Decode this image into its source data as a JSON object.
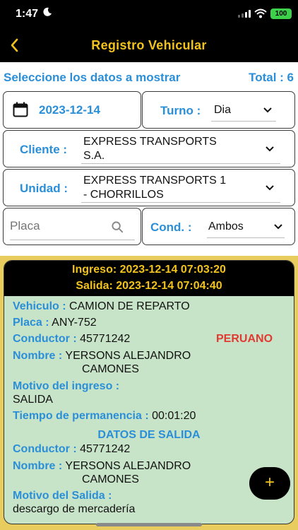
{
  "status": {
    "time": "1:47",
    "battery": "100"
  },
  "nav": {
    "title": "Registro Vehicular"
  },
  "header": {
    "prompt": "Seleccione los datos a mostrar",
    "total": "Total : 6"
  },
  "filters": {
    "date": "2023-12-14",
    "turno_label": "Turno :",
    "turno_value": "Dia",
    "cliente_label": "Cliente :",
    "cliente_line1": "EXPRESS TRANSPORTS",
    "cliente_line2": "S.A.",
    "unidad_label": "Unidad :",
    "unidad_line1": "EXPRESS TRANSPORTS 1",
    "unidad_line2": "- CHORRILLOS",
    "placa_placeholder": "Placa",
    "cond_label": "Cond. :",
    "cond_value": "Ambos"
  },
  "record": {
    "ingreso": "Ingreso: 2023-12-14 07:03:20",
    "salida": "Salida: 2023-12-14 07:04:40",
    "vehiculo_label": "Vehiculo :",
    "vehiculo": "CAMION DE REPARTO",
    "placa_label": "Placa :",
    "placa": "ANY-752",
    "conductor_label": "Conductor :",
    "conductor": "45771242",
    "nacionalidad": "PERUANO",
    "nombre_label": "Nombre :",
    "nombre_line1": "YERSONS ALEJANDRO",
    "nombre_line2": "CAMONES",
    "motivo_ingreso_label": "Motivo del ingreso :",
    "motivo_ingreso": "SALIDA",
    "permanencia_label": "Tiempo de permanencia :",
    "permanencia": "00:01:20",
    "datos_salida_title": "DATOS DE SALIDA",
    "salida_conductor_label": "Conductor :",
    "salida_conductor": "45771242",
    "salida_nombre_label": "Nombre :",
    "salida_nombre_line1": "YERSONS ALEJANDRO",
    "salida_nombre_line2": "CAMONES",
    "motivo_salida_label": "Motivo del Salida :",
    "motivo_salida": "descargo de mercadería"
  },
  "fab": {
    "label": "+"
  },
  "colors": {
    "accent_yellow": "#f2c21d",
    "label_blue": "#2a8fd8",
    "alert_red": "#e03a32",
    "card_green": "#c8e4c8"
  }
}
